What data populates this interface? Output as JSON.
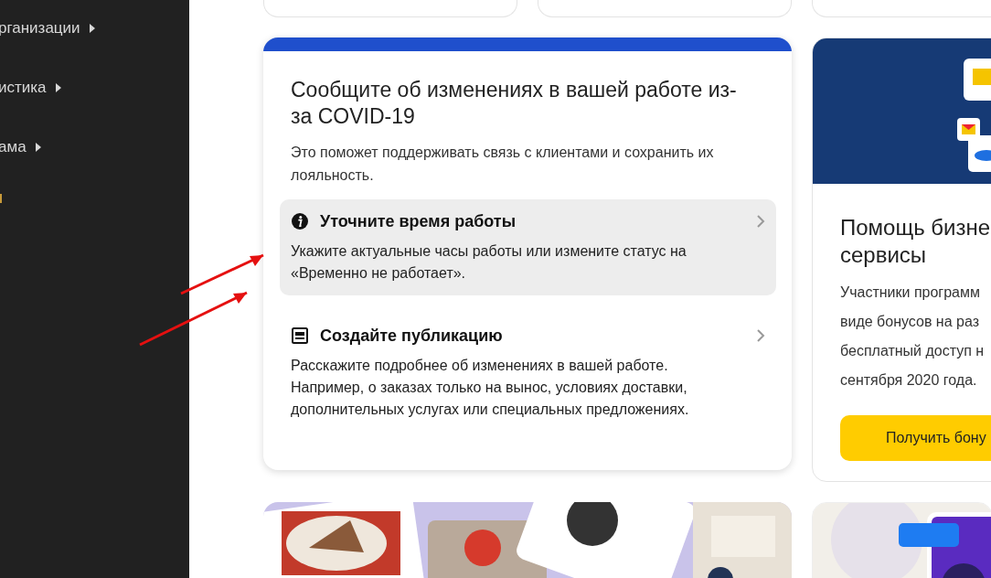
{
  "sidebar": {
    "items": [
      {
        "label": "рганизации"
      },
      {
        "label": "истика"
      },
      {
        "label": "ама"
      }
    ]
  },
  "covid_card": {
    "title": "Сообщите об изменениях в вашей работе из-за COVID-19",
    "description": "Это поможет поддерживать связь с клиентами и сохранить их лояльность.",
    "actions": [
      {
        "kind": "info",
        "title": "Уточните время работы",
        "text": "Укажите актуальные часы работы или измените статус на «Временно не работает».",
        "selected": true
      },
      {
        "kind": "post",
        "title": "Создайте публикацию",
        "text": "Расскажите подробнее об изменениях в вашей работе. Например, о заказах только на вынос, условиях доставки, дополнительных услугах или специальных предложениях.",
        "selected": false
      }
    ]
  },
  "promo_card": {
    "title_lines": [
      "Помощь бизне",
      "сервисы"
    ],
    "text_lines": [
      "Участники программ",
      "виде бонусов на раз",
      "бесплатный доступ н",
      "сентября 2020 года."
    ],
    "button": "Получить бону"
  }
}
